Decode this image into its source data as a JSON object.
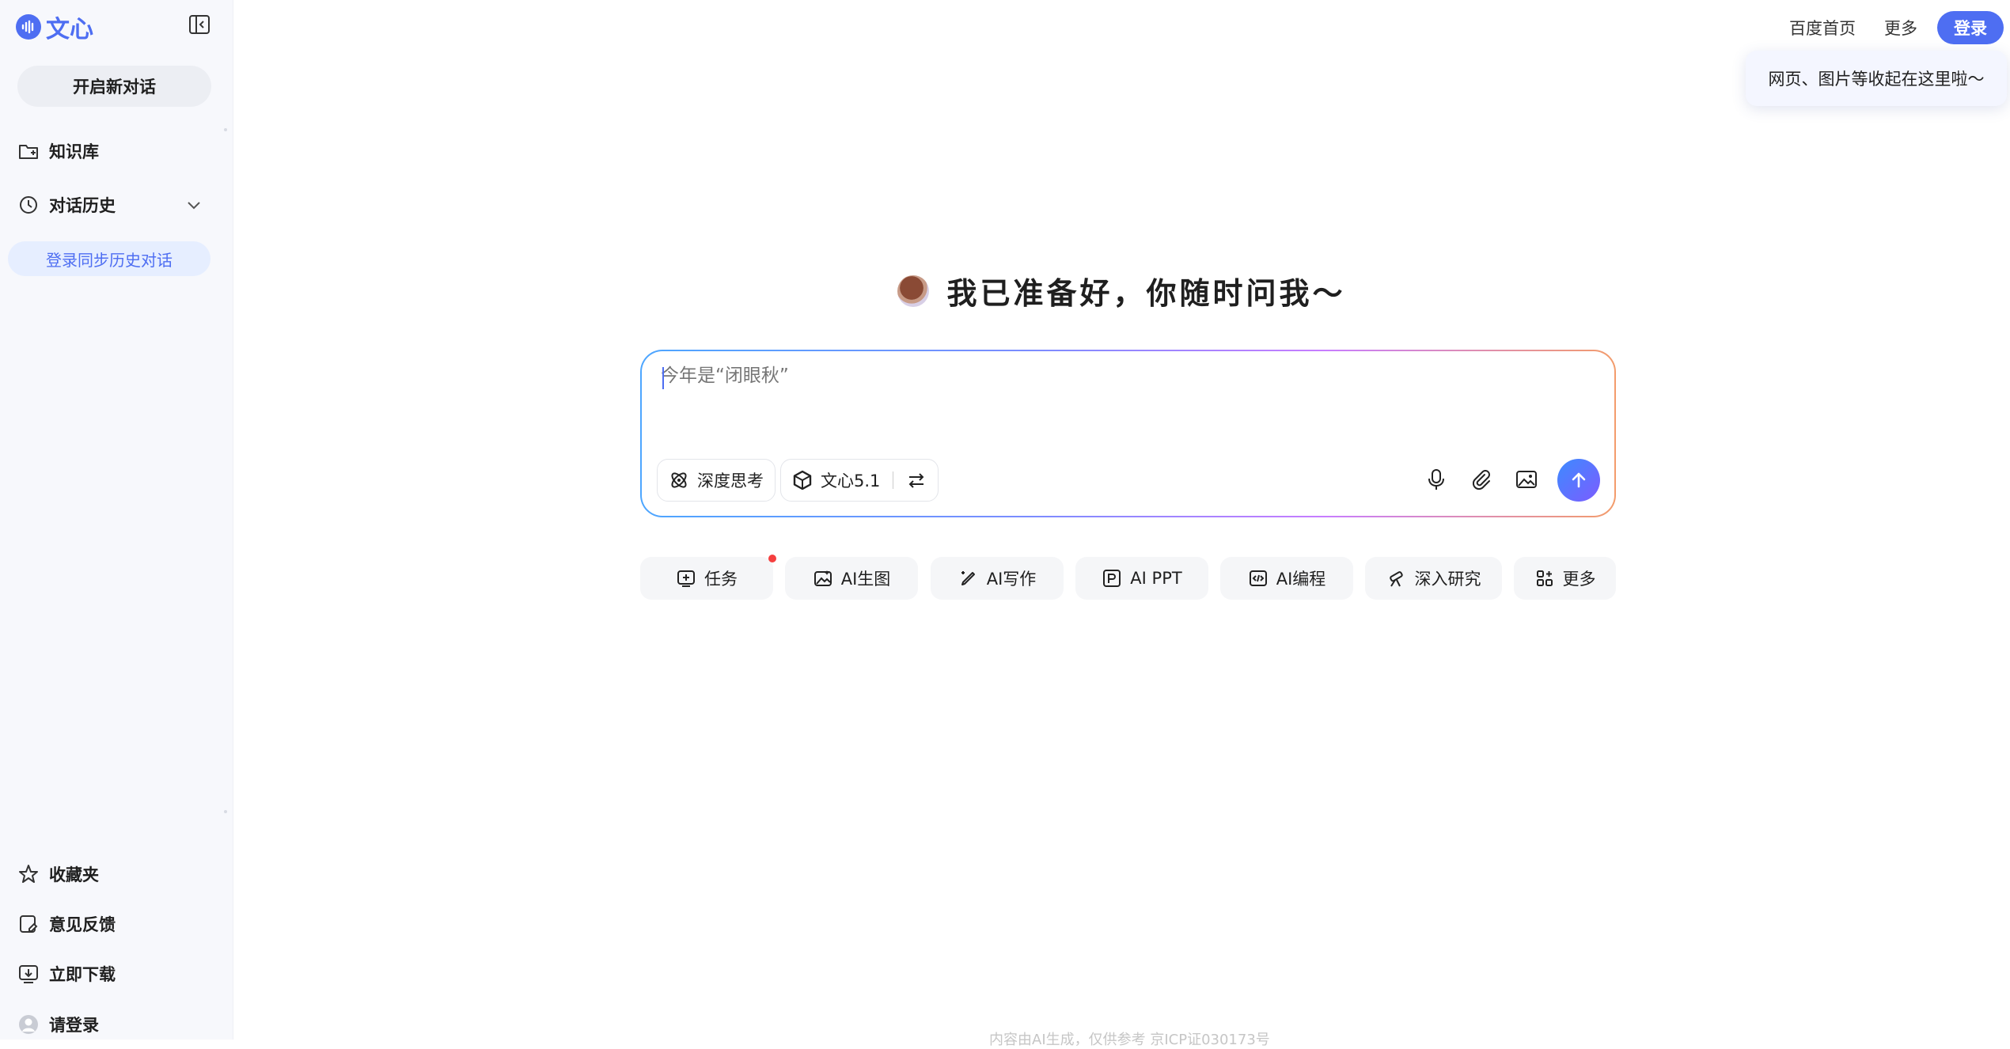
{
  "brand": {
    "name": "文心",
    "accent": "#4e6ef2"
  },
  "sidebar": {
    "new_chat": "开启新对话",
    "knowledge": "知识库",
    "history": "对话历史",
    "login_sync": "登录同步历史对话",
    "favorites": "收藏夹",
    "feedback": "意见反馈",
    "download": "立即下载",
    "login": "请登录"
  },
  "header": {
    "baidu_home": "百度首页",
    "more": "更多",
    "login": "登录",
    "tooltip": "网页、图片等收起在这里啦～"
  },
  "main": {
    "greeting": "我已准备好，你随时问我～",
    "input_placeholder": "今年是“闭眼秋”",
    "deep_think": "深度思考",
    "model": "文心5.1"
  },
  "quick_actions": [
    {
      "label": "任务",
      "icon": "task-icon"
    },
    {
      "label": "AI生图",
      "icon": "image-gen-icon"
    },
    {
      "label": "AI写作",
      "icon": "pen-icon"
    },
    {
      "label": "AI PPT",
      "icon": "ppt-icon"
    },
    {
      "label": "AI编程",
      "icon": "code-icon"
    },
    {
      "label": "深入研究",
      "icon": "telescope-icon"
    },
    {
      "label": "更多",
      "icon": "apps-icon"
    }
  ],
  "footer": "内容由AI生成，仅供参考 京ICP证030173号"
}
